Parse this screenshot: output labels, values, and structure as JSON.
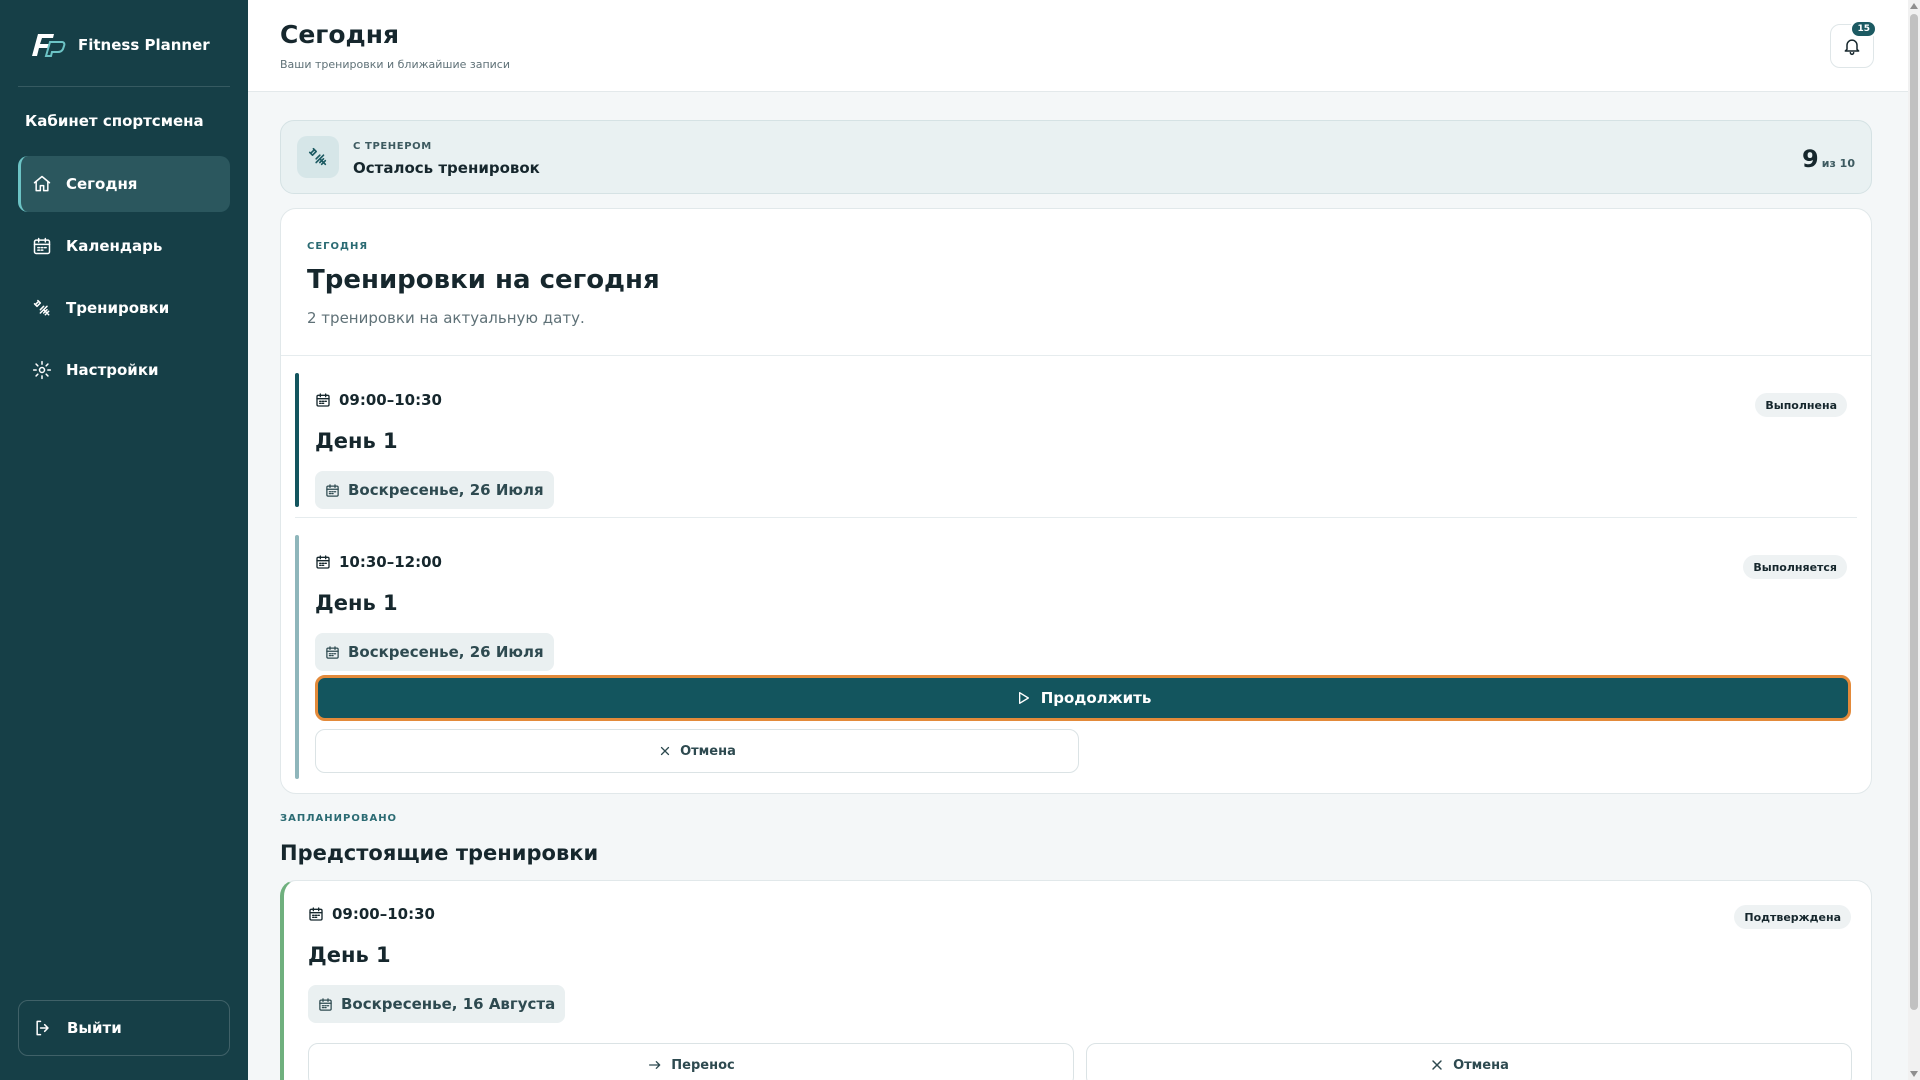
{
  "app": {
    "name": "Fitness Planner",
    "logo_icon": "fp-logo-icon"
  },
  "sidebar": {
    "section_title": "Кабинет спортсмена",
    "items": [
      {
        "label": "Сегодня",
        "icon": "home-icon",
        "active": true
      },
      {
        "label": "Календарь",
        "icon": "calendar-icon",
        "active": false
      },
      {
        "label": "Тренировки",
        "icon": "dumbbell-icon",
        "active": false
      },
      {
        "label": "Настройки",
        "icon": "gear-icon",
        "active": false
      }
    ],
    "logout_label": "Выйти"
  },
  "header": {
    "title": "Сегодня",
    "subtitle": "Ваши тренировки и ближайшие записи",
    "notifications_count": "15"
  },
  "remaining": {
    "kicker": "С ТРЕНЕРОМ",
    "label": "Осталось тренировок",
    "count": "9",
    "total_text": "из 10"
  },
  "today": {
    "kicker": "СЕГОДНЯ",
    "title": "Тренировки на сегодня",
    "description": "2 тренировки на актуальную дату.",
    "sessions": [
      {
        "time": "09:00–10:30",
        "name": "День 1",
        "date": "Воскресенье, 26 Июля",
        "status": "Выполнена"
      },
      {
        "time": "10:30–12:00",
        "name": "День 1",
        "date": "Воскресенье, 26 Июля",
        "status": "Выполняется",
        "continue_label": "Продолжить",
        "cancel_label": "Отмена"
      }
    ]
  },
  "upcoming": {
    "kicker": "ЗАПЛАНИРОВАНО",
    "title": "Предстоящие тренировки",
    "sessions": [
      {
        "time": "09:00–10:30",
        "name": "День 1",
        "date": "Воскресенье, 16 Августа",
        "status": "Подтверждена",
        "reschedule_label": "Перенос",
        "cancel_label": "Отмена"
      }
    ]
  },
  "colors": {
    "sidebar_bg": "#163f47",
    "primary": "#13555e",
    "focus_ring": "#e38a3a",
    "upcoming_accent": "#6fb07e"
  }
}
